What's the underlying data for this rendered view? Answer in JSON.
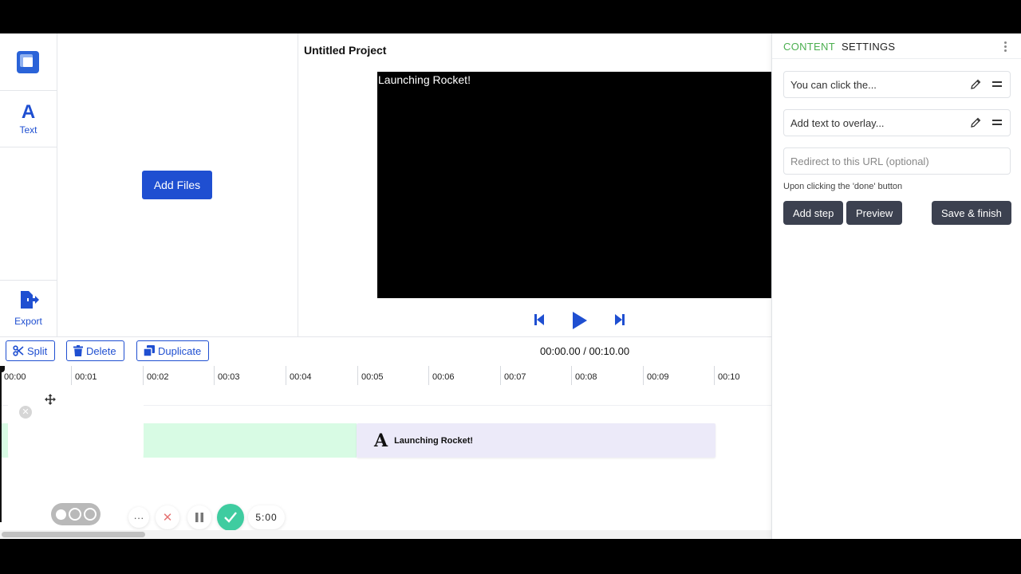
{
  "rail": {
    "text_label": "Text",
    "text_glyph": "A",
    "export_label": "Export"
  },
  "media": {
    "add_files_label": "Add Files"
  },
  "preview": {
    "project_title": "Untitled Project",
    "video_overlay_text": "Launching Rocket!"
  },
  "timeline": {
    "split_label": "Split",
    "delete_label": "Delete",
    "duplicate_label": "Duplicate",
    "timecode": "00:00.00 / 00:10.00",
    "ticks": [
      "00:00",
      "00:01",
      "00:02",
      "00:03",
      "00:04",
      "00:05",
      "00:06",
      "00:07",
      "00:08",
      "00:09",
      "00:10"
    ],
    "text_clip_glyph": "A",
    "text_clip_label": "Launching Rocket!"
  },
  "recorder": {
    "more_label": "···",
    "cancel_label": "✕",
    "time": "5:00"
  },
  "panel": {
    "tab_content": "CONTENT",
    "tab_settings": "SETTINGS",
    "step_field_value": "You can click the...",
    "overlay_field_placeholder": "Add text to overlay...",
    "url_field_placeholder": "Redirect to this URL (optional)",
    "url_hint": "Upon clicking the 'done' button",
    "add_step_label": "Add step",
    "preview_label": "Preview",
    "save_finish_label": "Save & finish"
  },
  "colors": {
    "accent_blue": "#1f4fd1",
    "tab_active": "#4caf50",
    "dark_button": "#3c4150",
    "clip_green": "#d8fbe4",
    "clip_text": "#eceaf9",
    "record_done": "#3fcca0"
  },
  "icons": [
    "logo-icon",
    "text-icon",
    "export-icon",
    "skip-back-icon",
    "play-icon",
    "skip-forward-icon",
    "scissors-icon",
    "trash-icon",
    "duplicate-icon",
    "move-icon",
    "close-icon",
    "pause-icon",
    "check-icon",
    "pencil-icon",
    "drag-handle-icon",
    "kebab-menu-icon"
  ]
}
